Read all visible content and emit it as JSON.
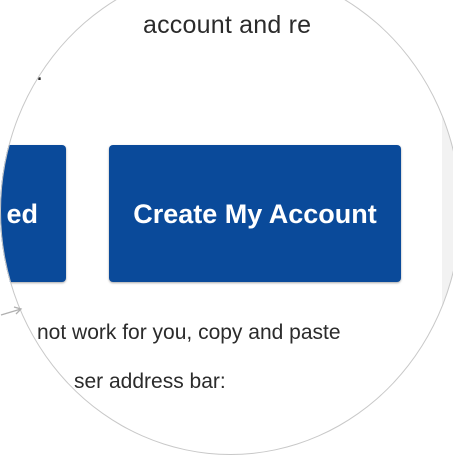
{
  "email": {
    "line_1": "account and re",
    "line_2": ".",
    "button_left_label": "ed",
    "button_main_label": "Create My Account",
    "line_3": "not work for you, copy and paste",
    "line_4": "ser address bar:"
  },
  "icons": {
    "arrow": "arrow-right-icon"
  },
  "colors": {
    "button_background": "#0a4a9a",
    "button_text": "#ffffff",
    "body_text": "#2b2b2b",
    "lens_border": "#c8c8c8"
  }
}
